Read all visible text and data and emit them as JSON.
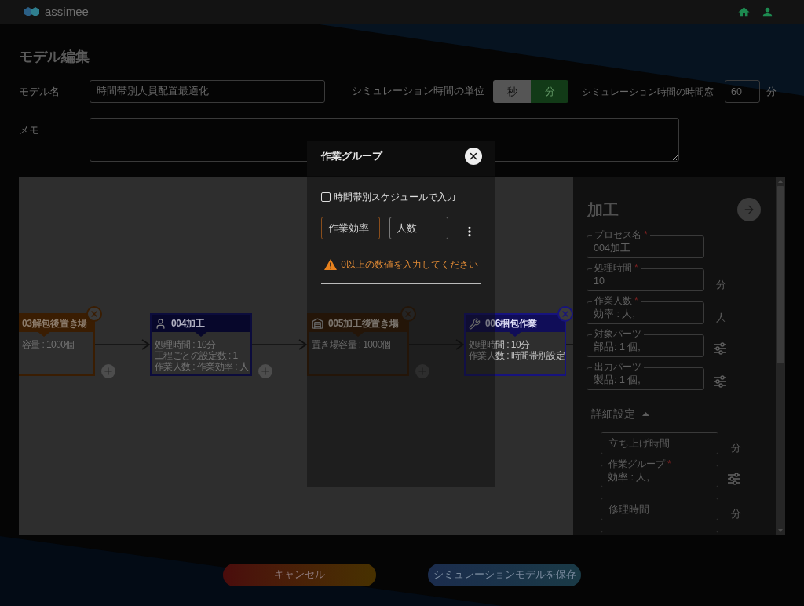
{
  "header": {
    "logo_text": "assimee"
  },
  "title": "モデル編集",
  "form": {
    "model_name": {
      "label": "モデル名",
      "value": "時間帯別人員配置最適化"
    },
    "time_unit": {
      "label": "シミュレーション時間の単位",
      "options": [
        {
          "label": "秒",
          "selected": false
        },
        {
          "label": "分",
          "selected": true
        }
      ]
    },
    "time_window": {
      "label": "シミュレーション時間の時間窓",
      "value": "60",
      "unit": "分"
    },
    "memo": {
      "label": "メモ"
    }
  },
  "canvas": {
    "nodes": [
      {
        "kind": "storage",
        "title": "03解包後置き場",
        "lines": [
          "容量 : 1000個"
        ],
        "removable": true
      },
      {
        "kind": "processing",
        "title": "004加工",
        "lines": [
          "処理時間 : 10分",
          "工程ごとの設定数 : 1",
          "作業人数 : 作業効率 : 人"
        ],
        "removable": false
      },
      {
        "kind": "storage",
        "title": "005加工後置き場",
        "lines": [
          "置き場容量 : 1000個"
        ],
        "removable": true
      },
      {
        "kind": "packing",
        "title": "006梱包作業",
        "lines": [
          "処理時間 : 10分",
          "作業人数 : 時間帯別設定"
        ],
        "removable": true
      }
    ]
  },
  "panel": {
    "title": "加工",
    "fields": [
      {
        "kind": "text",
        "label": "プロセス名",
        "required_mark": "*",
        "value": "004加工"
      },
      {
        "kind": "text",
        "label": "処理時間",
        "required_mark": "*",
        "value": "10",
        "unit": "分"
      },
      {
        "kind": "text",
        "label": "作業人数",
        "required_mark": "*",
        "value": "効率 : 人,",
        "unit": "人"
      },
      {
        "kind": "picker",
        "label": "対象パーツ",
        "value": "部品: 1 個,"
      },
      {
        "kind": "picker",
        "label": "出力パーツ",
        "value": "製品: 1 個,"
      }
    ],
    "details": {
      "label": "詳細設定",
      "expanded": true,
      "fields": [
        {
          "kind": "text",
          "placeholder": "立ち上げ時間",
          "unit": "分"
        },
        {
          "kind": "picker",
          "label": "作業グループ",
          "required_mark": "*",
          "value": "効率 : 人,"
        },
        {
          "kind": "text",
          "placeholder": "修理時間",
          "unit": "分"
        },
        {
          "kind": "text"
        }
      ]
    }
  },
  "dialog": {
    "title": "作業グループ",
    "schedule_option": {
      "label": "時間帯別スケジュールで入力",
      "checked": false
    },
    "inputs": [
      {
        "placeholder": "作業効率",
        "error": true
      },
      {
        "placeholder": "人数",
        "error": false
      }
    ],
    "error_message": "0以上の数値を入力してください"
  },
  "actions": [
    {
      "kind": "cancel",
      "label": "キャンセル"
    },
    {
      "kind": "save",
      "label": "シミュレーションモデルを保存"
    }
  ]
}
